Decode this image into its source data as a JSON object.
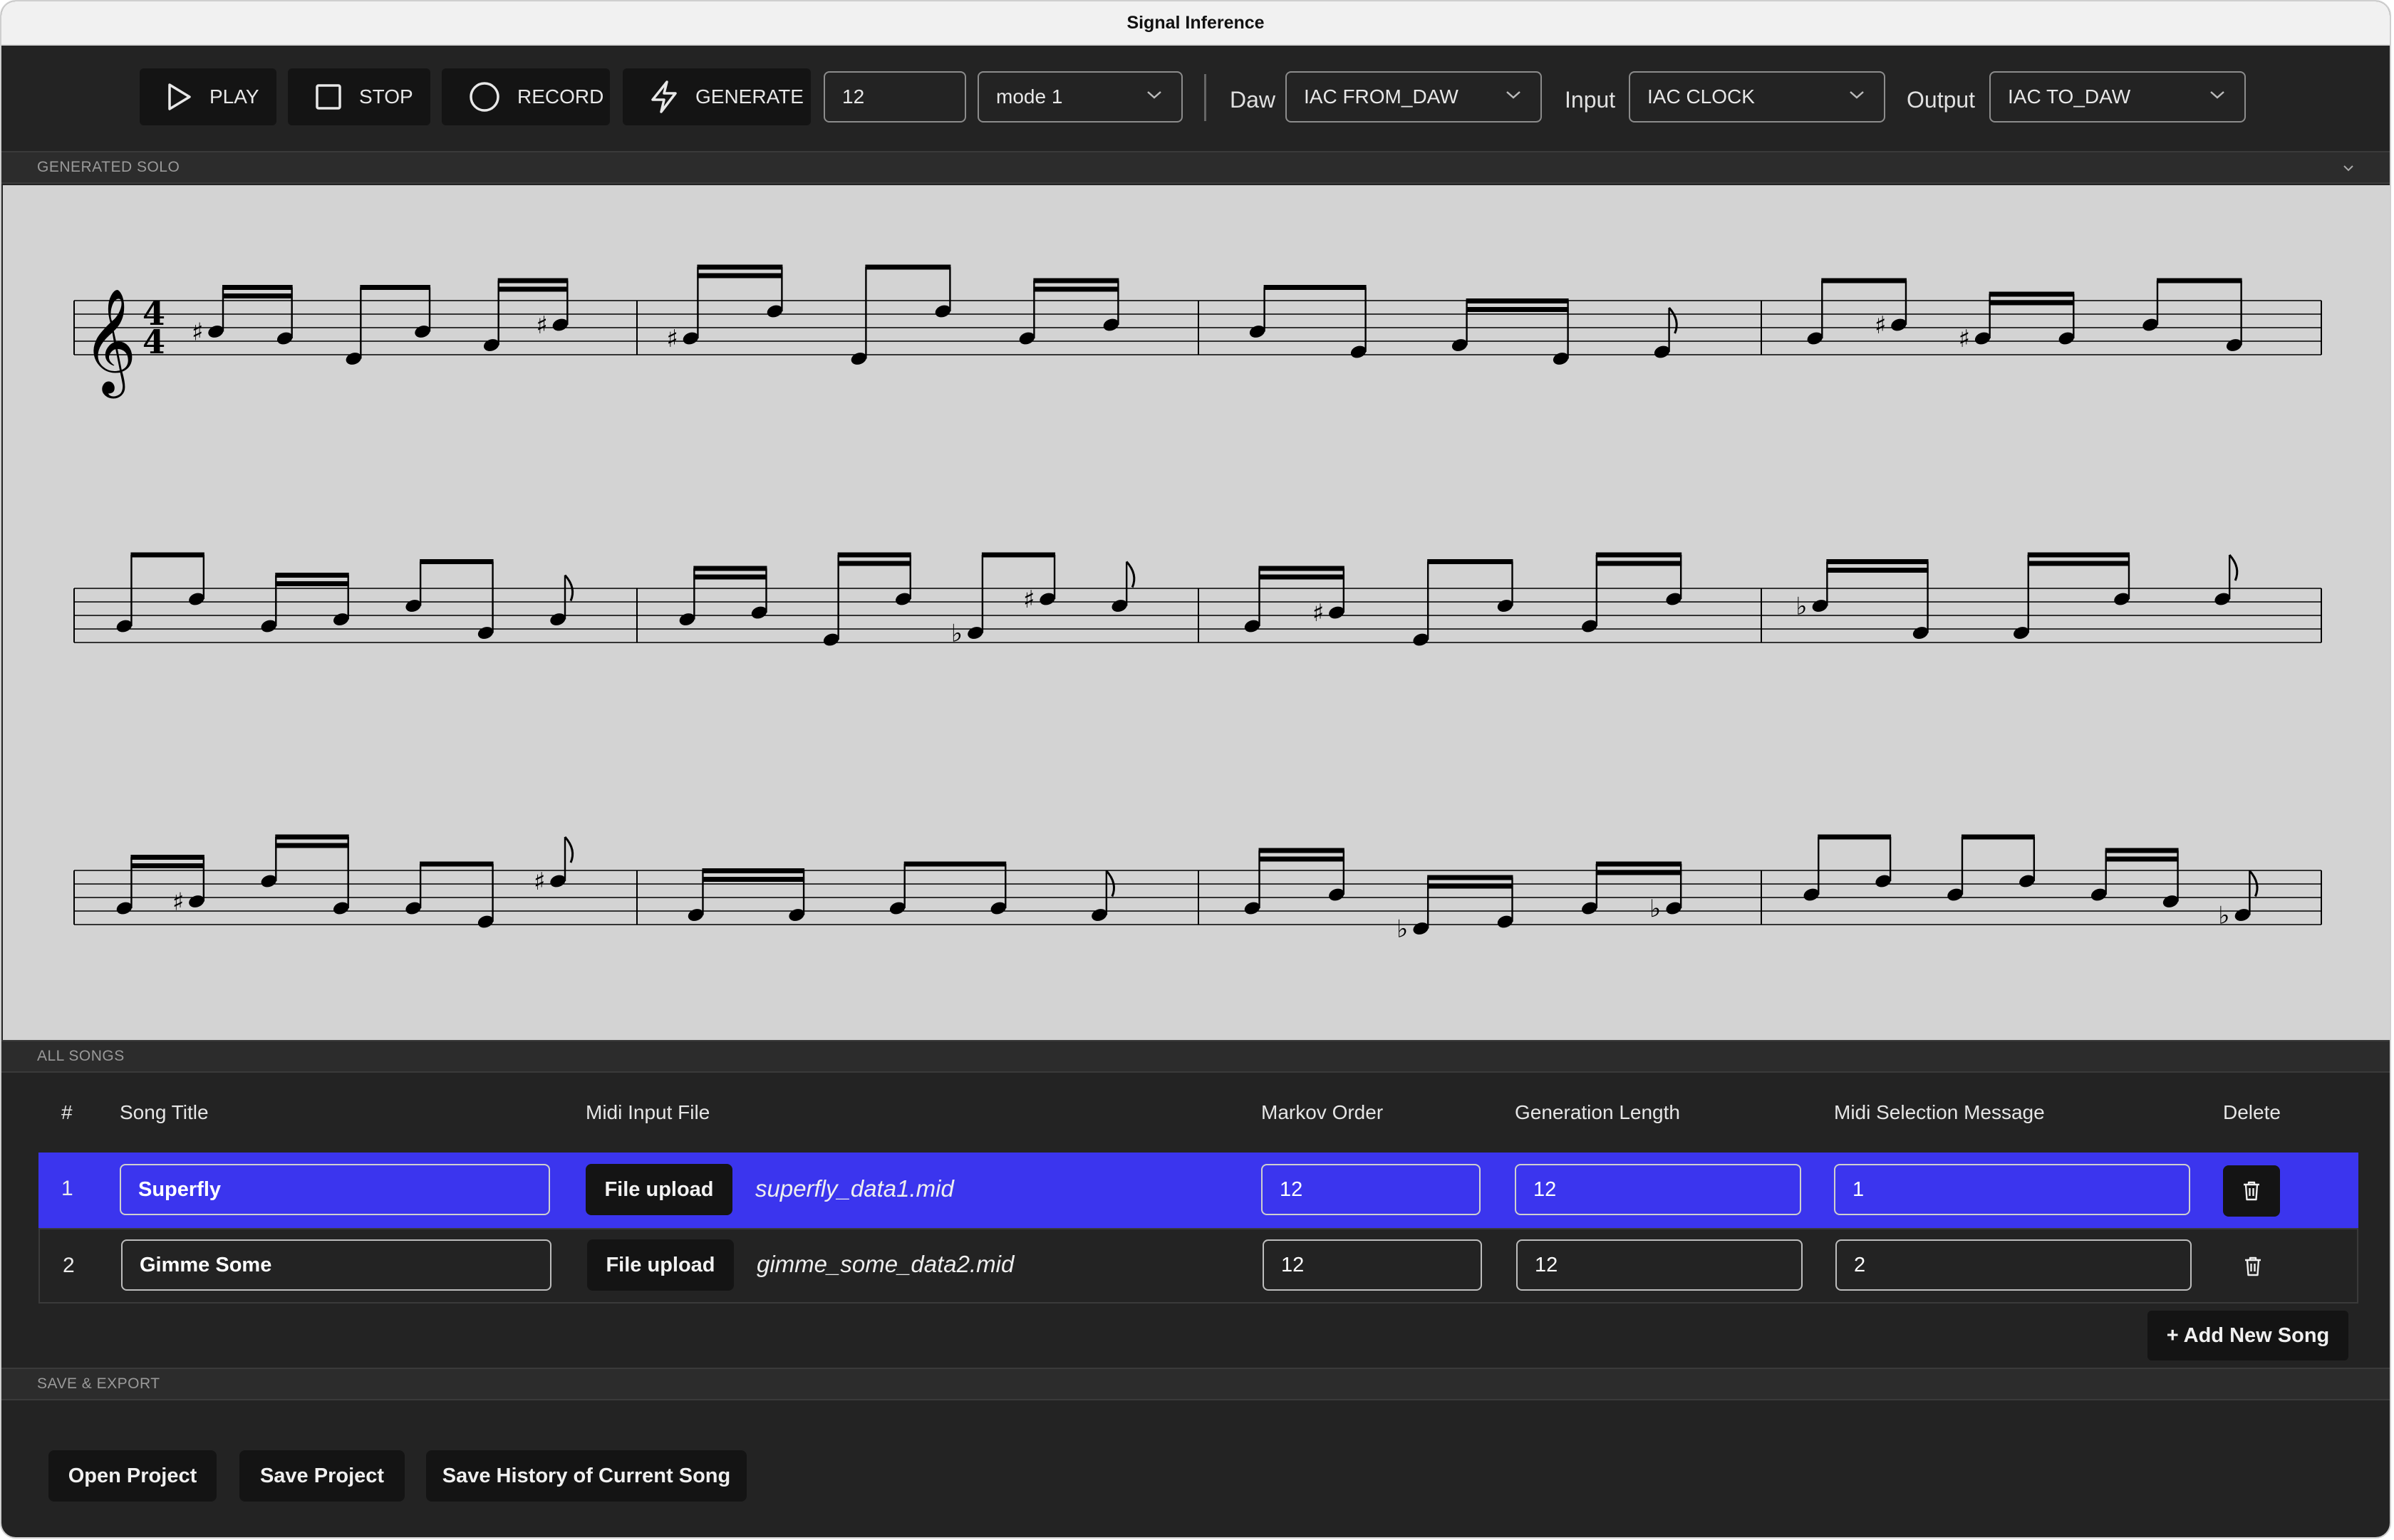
{
  "window": {
    "title": "Signal Inference"
  },
  "toolbar": {
    "play_label": "PLAY",
    "stop_label": "STOP",
    "record_label": "RECORD",
    "generate_label": "GENERATE",
    "length_value": "12",
    "mode_value": "mode 1",
    "daw_label": "Daw",
    "daw_value": "IAC FROM_DAW",
    "input_label": "Input",
    "input_value": "IAC CLOCK",
    "output_label": "Output",
    "output_value": "IAC TO_DAW"
  },
  "sections": {
    "solo": "GENERATED SOLO",
    "songs": "ALL SONGS",
    "export": "SAVE & EXPORT"
  },
  "score": {
    "time_signature_top": "4",
    "time_signature_bottom": "4",
    "systems": 3,
    "measures_per_system": 4
  },
  "table": {
    "headers": {
      "num": "#",
      "title": "Song Title",
      "midi": "Midi Input File",
      "markov": "Markov Order",
      "gen_len": "Generation Length",
      "midi_msg": "Midi Selection Message",
      "delete": "Delete"
    },
    "rows": [
      {
        "num": "1",
        "title": "Superfly",
        "upload": "File upload",
        "file": "superfly_data1.mid",
        "markov": "12",
        "gen_len": "12",
        "midi_msg": "1",
        "selected": true
      },
      {
        "num": "2",
        "title": "Gimme Some",
        "upload": "File upload",
        "file": "gimme_some_data2.mid",
        "markov": "12",
        "gen_len": "12",
        "midi_msg": "2",
        "selected": false
      }
    ],
    "add_label": "+ Add New Song"
  },
  "footer": {
    "open_label": "Open Project",
    "save_label": "Save Project",
    "history_label": "Save History of Current Song"
  },
  "colors": {
    "selected_row": "#3b35ee",
    "background": "#232323",
    "score_bg": "#d3d3d3"
  },
  "icons": [
    "play-icon",
    "stop-icon",
    "record-icon",
    "lightning-icon",
    "chevron-down-icon",
    "trash-icon"
  ]
}
